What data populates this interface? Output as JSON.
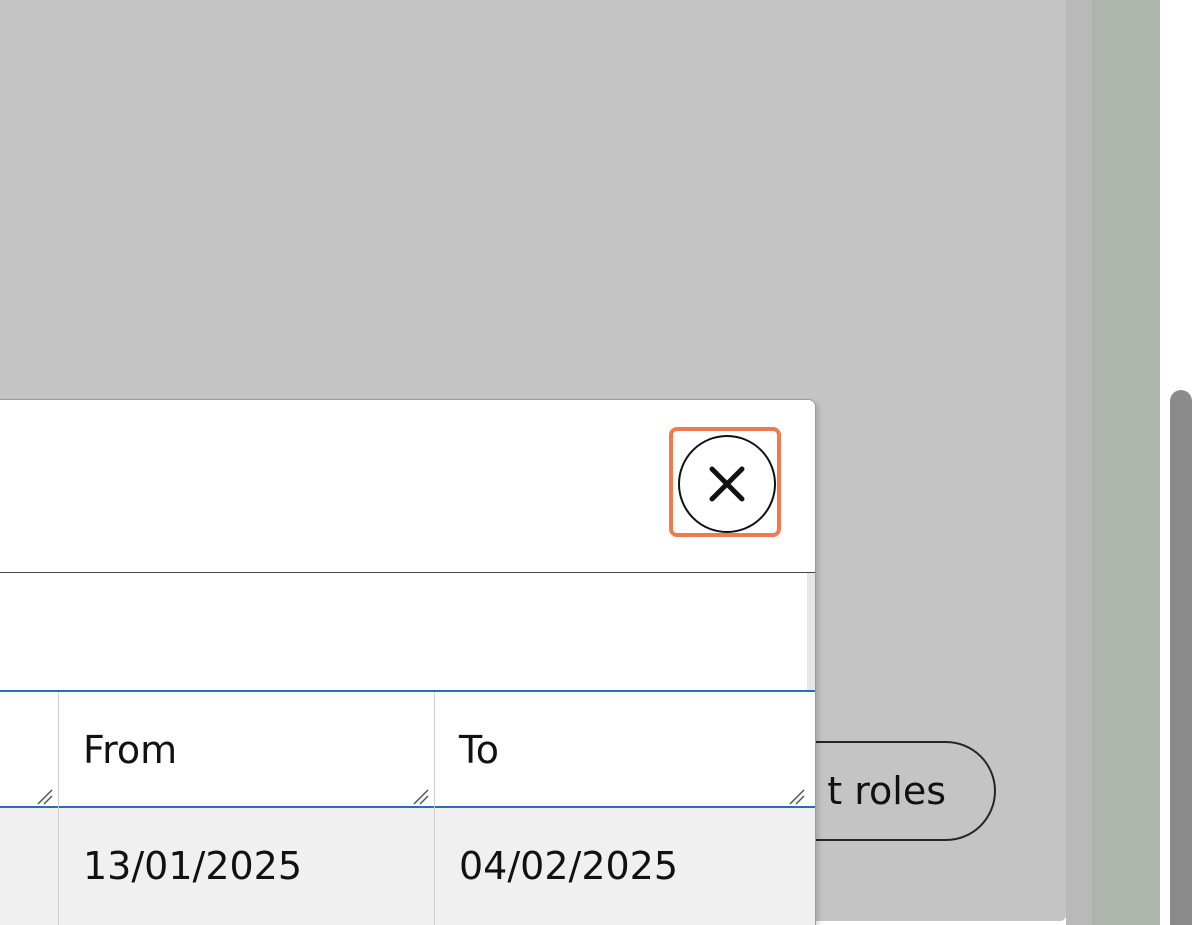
{
  "background_button": {
    "label": "t roles"
  },
  "dialog": {
    "close_icon": "close-x-icon",
    "table": {
      "columns": [
        "From",
        "To"
      ],
      "rows": [
        {
          "from": "13/01/2025",
          "to": "04/02/2025"
        }
      ]
    }
  },
  "colors": {
    "overlay": "#c4c4c4",
    "focus_ring": "#f07a4e",
    "header_rule": "#2a6db5",
    "row_background": "#f0f0f0",
    "side_strip": "#adb5ac",
    "scrollbar_thumb": "#8b8b8b"
  }
}
